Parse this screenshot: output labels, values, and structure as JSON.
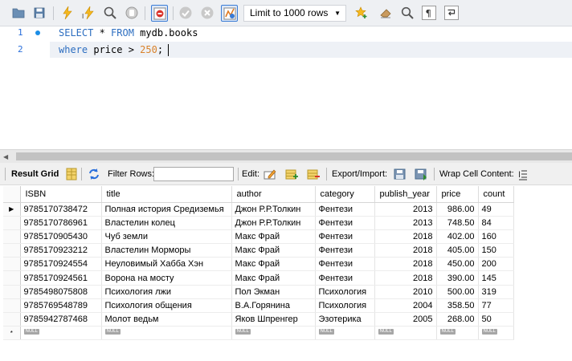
{
  "toolbar": {
    "limit_label": "Limit to 1000 rows",
    "icons": [
      "open-folder-icon",
      "save-icon",
      "execute-icon",
      "execute-current-icon",
      "explain-icon",
      "stop-icon",
      "toggle-results-icon",
      "commit-icon",
      "rollback-icon",
      "autocommit-icon",
      "beautify-icon",
      "eraser-icon",
      "find-icon",
      "invisible-chars-icon",
      "wrap-icon"
    ]
  },
  "editor": {
    "lines": [
      {
        "number": "1",
        "keyword1": "SELECT",
        "rest1": " * ",
        "keyword2": "FROM",
        "rest2": " mydb.books"
      },
      {
        "number": "2",
        "keyword1": "where",
        "rest1": " price > ",
        "value": "250",
        "rest2": ";"
      }
    ]
  },
  "result_toolbar": {
    "result_grid_label": "Result Grid",
    "filter_rows_label": "Filter Rows:",
    "filter_value": "",
    "edit_label": "Edit:",
    "export_label": "Export/Import:",
    "wrap_label": "Wrap Cell Content:"
  },
  "grid": {
    "columns": [
      "ISBN",
      "title",
      "author",
      "category",
      "publish_year",
      "price",
      "count"
    ],
    "rows": [
      [
        "9785170738472",
        "Полная история Средиземья",
        "Джон Р.Р.Толкин",
        "Фентези",
        "2013",
        "986.00",
        "49"
      ],
      [
        "9785170786961",
        "Властелин колец",
        "Джон Р.Р.Толкин",
        "Фентези",
        "2013",
        "748.50",
        "84"
      ],
      [
        "9785170905430",
        "Чуб земли",
        "Макс Фрай",
        "Фентези",
        "2018",
        "402.00",
        "160"
      ],
      [
        "9785170923212",
        "Властелин Морморы",
        "Макс Фрай",
        "Фентези",
        "2018",
        "405.00",
        "150"
      ],
      [
        "9785170924554",
        "Неуловимый Хабба Хэн",
        "Макс Фрай",
        "Фентези",
        "2018",
        "450.00",
        "200"
      ],
      [
        "9785170924561",
        "Ворона на мосту",
        "Макс Фрай",
        "Фентези",
        "2018",
        "390.00",
        "145"
      ],
      [
        "9785498075808",
        "Психология лжи",
        "Пол Экман",
        "Психология",
        "2010",
        "500.00",
        "319"
      ],
      [
        "9785769548789",
        "Психология общения",
        "В.А.Горянина",
        "Психология",
        "2004",
        "358.50",
        "77"
      ],
      [
        "9785942787468",
        "Молот ведьм",
        "Яков Шпренгер",
        "Эзотерика",
        "2005",
        "268.00",
        "50"
      ]
    ],
    "null_label": "NULL",
    "current_row_marker": "▶",
    "new_row_marker": "*"
  }
}
